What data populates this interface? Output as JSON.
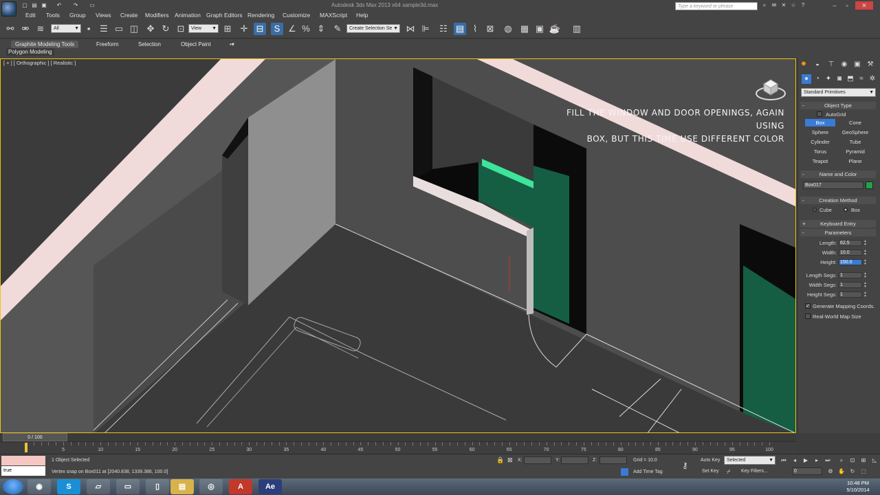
{
  "title_bar": {
    "title": "Autodesk 3ds Max 2013 x64    sample3d.max",
    "search_placeholder": "Type a keyword or phrase"
  },
  "menu": {
    "items": [
      "Edit",
      "Tools",
      "Group",
      "Views",
      "Create",
      "Modifiers",
      "Animation",
      "Graph Editors",
      "Rendering",
      "Customize",
      "MAXScript",
      "Help"
    ]
  },
  "toolbar": {
    "selection_filter": "All",
    "ref_coord": "View",
    "named_selection_set": "Create Selection Se"
  },
  "ribbon": {
    "tabs": [
      "Graphite Modeling Tools",
      "Freeform",
      "Selection",
      "Object Paint"
    ],
    "sub_label": "Polygon Modeling"
  },
  "viewport": {
    "label": "[ + ] [ Orthographic ] [ Realistic ]",
    "overlay_line1": "FILL THE WINDOW AND DOOR OPENINGS, AGAIN USING",
    "overlay_line2": "BOX, BUT THIS TIME USE DIFFERENT COLOR"
  },
  "command_panel": {
    "category": "Standard Primitives",
    "object_type_title": "Object Type",
    "autogrid_label": "AutoGrid",
    "primitives": [
      "Box",
      "Cone",
      "Sphere",
      "GeoSphere",
      "Cylinder",
      "Tube",
      "Torus",
      "Pyramid",
      "Teapot",
      "Plane"
    ],
    "active_primitive": "Box",
    "name_color_title": "Name and Color",
    "object_name": "Box017",
    "object_color": "#1fa34a",
    "creation_method_title": "Creation Method",
    "creation_cube": "Cube",
    "creation_box": "Box",
    "keyboard_entry_title": "Keyboard Entry",
    "parameters_title": "Parameters",
    "params": {
      "length_label": "Length:",
      "length": "62.5",
      "width_label": "Width:",
      "width": "10.0",
      "height_label": "Height:",
      "height": "150.0",
      "length_segs_label": "Length Segs:",
      "length_segs": "1",
      "width_segs_label": "Width Segs:",
      "width_segs": "1",
      "height_segs_label": "Height Segs:",
      "height_segs": "1"
    },
    "gen_mapping_label": "Generate Mapping Coords.",
    "real_world_label": "Real-World Map Size"
  },
  "timeline": {
    "frame_readout": "0 / 100",
    "ticks": [
      "5",
      "10",
      "15",
      "20",
      "25",
      "30",
      "35",
      "40",
      "45",
      "50",
      "55",
      "60",
      "65",
      "70",
      "75",
      "80",
      "85",
      "90",
      "95",
      "100"
    ]
  },
  "status": {
    "maxscript_value": "true",
    "selected_text": "1 Object Selected",
    "prompt_text": "Vertex snap on Box011 at [2040.838, 1339.386, 100.0]",
    "x_label": "X:",
    "y_label": "Y:",
    "z_label": "Z:",
    "grid_text": "Grid = 10.0",
    "add_time_tag": "Add Time Tag",
    "auto_key": "Auto Key",
    "auto_key_mode": "Selected",
    "set_key": "Set Key",
    "key_filters": "Key Filters...",
    "current_frame": "0"
  },
  "taskbar": {
    "clock_time": "10:48 PM",
    "clock_date": "5/10/2014"
  }
}
